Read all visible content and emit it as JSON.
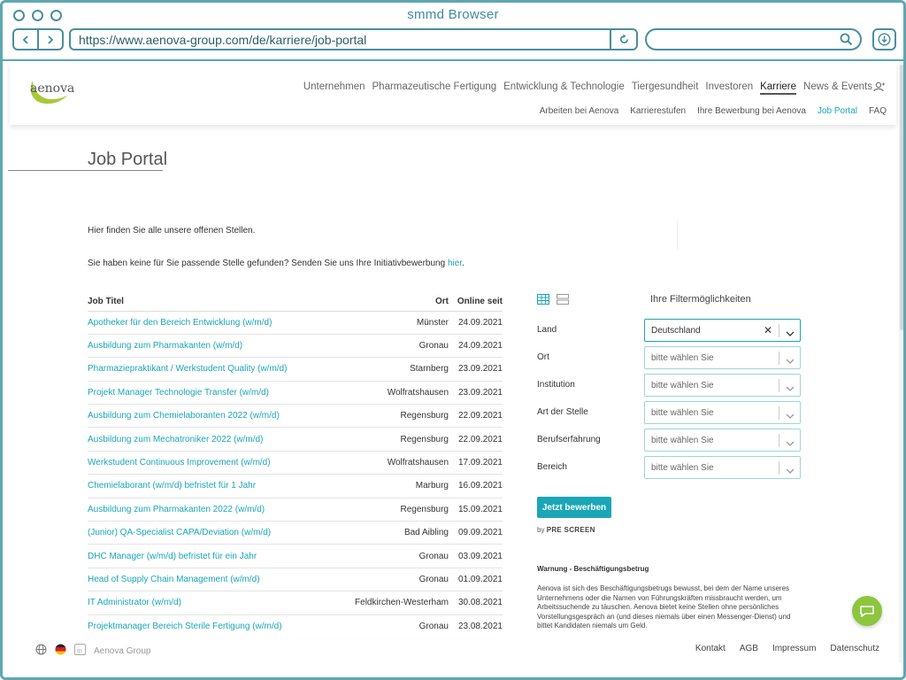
{
  "browser": {
    "title": "smmd Browser",
    "url": "https://www.aenova-group.com/de/karriere/job-portal",
    "search_value": ""
  },
  "header": {
    "logo_text": "aenova",
    "nav": [
      "Unternehmen",
      "Pharmazeutische Fertigung",
      "Entwicklung & Technologie",
      "Tiergesundheit",
      "Investoren",
      "Karriere",
      "News & Events"
    ],
    "nav_active": "Karriere",
    "subnav": [
      "Arbeiten bei Aenova",
      "Karrierestufen",
      "Ihre Bewerbung bei Aenova",
      "Job Portal",
      "FAQ"
    ],
    "subnav_current": "Job Portal"
  },
  "page": {
    "title": "Job Portal",
    "intro": "Hier finden Sie alle unsere offenen Stellen.",
    "initiative_text": "Sie haben keine für Sie passende Stelle gefunden? Senden Sie uns Ihre Initiativbewerbung ",
    "initiative_link": "hier",
    "initiative_end": "."
  },
  "jobs": {
    "headers": {
      "title": "Job Titel",
      "ort": "Ort",
      "date": "Online seit"
    },
    "rows": [
      {
        "title": "Apotheker für den Bereich Entwicklung (w/m/d)",
        "ort": "Münster",
        "date": "24.09.2021"
      },
      {
        "title": "Ausbildung zum Pharmakanten (w/m/d)",
        "ort": "Gronau",
        "date": "24.09.2021"
      },
      {
        "title": "Pharmaziepraktikant / Werkstudent Quality (w/m/d)",
        "ort": "Starnberg",
        "date": "23.09.2021"
      },
      {
        "title": "Projekt Manager Technologie Transfer (w/m/d)",
        "ort": "Wolfratshausen",
        "date": "23.09.2021"
      },
      {
        "title": "Ausbildung zum Chemielaboranten 2022 (w/m/d)",
        "ort": "Regensburg",
        "date": "22.09.2021"
      },
      {
        "title": "Ausbildung zum Mechatroniker 2022 (w/m/d)",
        "ort": "Regensburg",
        "date": "22.09.2021"
      },
      {
        "title": "Werkstudent Continuous Improvement (w/m/d)",
        "ort": "Wolfratshausen",
        "date": "17.09.2021"
      },
      {
        "title": "Chemielaborant (w/m/d) befristet für 1 Jahr",
        "ort": "Marburg",
        "date": "16.09.2021"
      },
      {
        "title": "Ausbildung zum Pharmakanten 2022 (w/m/d)",
        "ort": "Regensburg",
        "date": "15.09.2021"
      },
      {
        "title": "(Junior) QA-Specialist CAPA/Deviation (w/m/d)",
        "ort": "Bad Aibling",
        "date": "09.09.2021"
      },
      {
        "title": "DHC Manager (w/m/d) befristet für ein Jahr",
        "ort": "Gronau",
        "date": "03.09.2021"
      },
      {
        "title": "Head of Supply Chain Management (w/m/d)",
        "ort": "Gronau",
        "date": "01.09.2021"
      },
      {
        "title": "IT Administrator (w/m/d)",
        "ort": "Feldkirchen-Westerham",
        "date": "30.08.2021"
      },
      {
        "title": "Projektmanager Bereich Sterile Fertigung (w/m/d)",
        "ort": "Gronau",
        "date": "23.08.2021"
      }
    ]
  },
  "filters": {
    "heading": "Ihre Filtermöglichkeiten",
    "items": [
      {
        "label": "Land",
        "value": "Deutschland",
        "placeholder": "bitte wählen Sie"
      },
      {
        "label": "Ort",
        "value": "",
        "placeholder": "bitte wählen Sie"
      },
      {
        "label": "Institution",
        "value": "",
        "placeholder": "bitte wählen Sie"
      },
      {
        "label": "Art der Stelle",
        "value": "",
        "placeholder": "bitte wählen Sie"
      },
      {
        "label": "Berufserfahrung",
        "value": "",
        "placeholder": "bitte wählen Sie"
      },
      {
        "label": "Bereich",
        "value": "",
        "placeholder": "bitte wählen Sie"
      }
    ],
    "apply_label": "Jetzt bewerben",
    "by_label": "by",
    "by_brand": "PRE SCREEN"
  },
  "warning": {
    "title": "Warnung - Beschäftigungsbetrug",
    "text": "Aenova ist sich des Beschäftigungsbetrugs bewusst, bei dem der Name unseres Unternehmens oder die Namen von Führungskräften missbraucht werden, um Arbeitssuchende zu täuschen. Aenova bietet keine Stellen ohne persönliches Vorstellungsgespräch an (und dieses niemals über einen Messenger-Dienst) und bittet Kandidaten niemals um Geld."
  },
  "footer": {
    "group_label": "Aenova Group",
    "links": [
      "Kontakt",
      "AGB",
      "Impressum",
      "Datenschutz"
    ]
  },
  "colors": {
    "frame": "#5fa7b2",
    "accent": "#1aa6b7",
    "logo_green": "#a8c93a",
    "chat": "#8cc63f"
  }
}
